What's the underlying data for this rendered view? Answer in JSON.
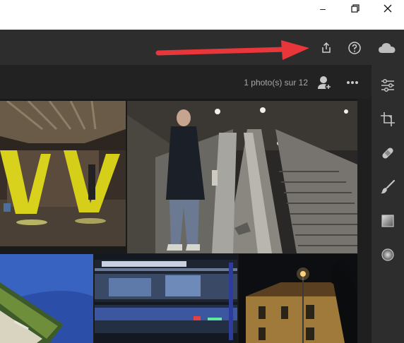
{
  "window": {
    "minimize_label": "–",
    "maximize_icon": "restore-icon",
    "close_icon": "close-icon"
  },
  "toolbar": {
    "share_icon": "share-icon",
    "help_icon": "help-icon",
    "cloud_icon": "cloud-icon"
  },
  "grid_header": {
    "count_text": "1 photo(s) sur 12",
    "add_person_icon": "add-person-icon",
    "more_icon": "more-icon"
  },
  "side_panel": {
    "icons": [
      "adjust-sliders-icon",
      "crop-icon",
      "heal-icon",
      "brush-icon",
      "gradient-icon",
      "radial-icon"
    ]
  },
  "annotation": {
    "arrow_color": "#e8363a"
  },
  "photos": [
    {
      "name": "photo-yellow-v-sculpture",
      "selected": false
    },
    {
      "name": "photo-man-on-escalator",
      "selected": true
    },
    {
      "name": "photo-green-bridge-blue",
      "selected": false
    },
    {
      "name": "photo-night-tram-motion",
      "selected": false
    },
    {
      "name": "photo-night-building-streetlamp",
      "selected": false
    }
  ]
}
